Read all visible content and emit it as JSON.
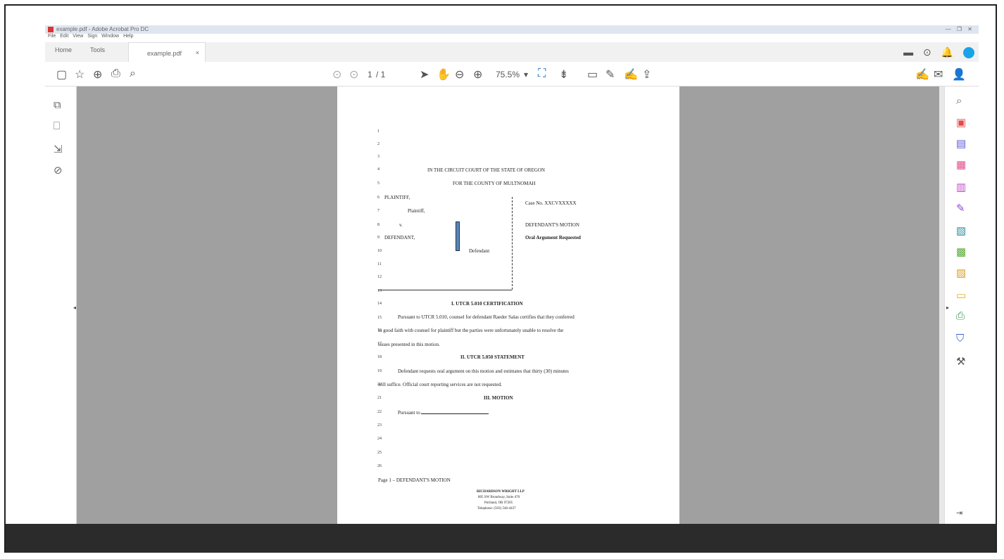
{
  "window": {
    "title": "example.pdf - Adobe Acrobat Pro DC",
    "controls": "— ❐ ✕"
  },
  "menu": [
    "File",
    "Edit",
    "View",
    "Sign",
    "Window",
    "Help"
  ],
  "tabs": {
    "home": "Home",
    "tools": "Tools",
    "document": "example.pdf",
    "close": "×"
  },
  "toolbar": {
    "page_current": "1",
    "page_total": "/ 1",
    "zoom": "75.5%"
  },
  "document": {
    "line_numbers": [
      "1",
      "2",
      "3",
      "4",
      "5",
      "6",
      "7",
      "8",
      "9",
      "10",
      "11",
      "12",
      "13",
      "14",
      "15",
      "16",
      "17",
      "18",
      "19",
      "20",
      "21",
      "22",
      "23",
      "24",
      "25",
      "26"
    ],
    "court_line1": "IN THE CIRCUIT COURT OF THE STATE OF OREGON",
    "court_line2": "FOR THE COUNTY OF MULTNOMAH",
    "plaintiff": "PLAINTIFF,",
    "plaintiff_role": "Plaintiff,",
    "versus": "v.",
    "defendant": "DEFENDANT,",
    "defendant_role": "Defendant",
    "case_no": "Case No. XXCVXXXXX",
    "motion_title": "DEFENDANT'S MOTION",
    "oral_argument": "Oral Argument Requested",
    "section1_heading": "I.     UTCR 5.010 CERTIFICATION",
    "section1_p1": "Pursuant to UTCR 5.010, counsel for defendant Raeder Salas certifies that they conferred",
    "section1_p2": "in good faith with counsel for plaintiff but the parties were unfortunately unable to resolve the",
    "section1_p3": "issues presented in this motion.",
    "section2_heading": "II.     UTCR 5.050 STATEMENT",
    "section2_p1": "Defendant requests oral argument on this motion and estimates that thirty (30) minutes",
    "section2_p2": "will suffice.  Official court reporting services are not requested.",
    "section3_heading": "III.     MOTION",
    "section3_p1": "Pursuant to",
    "footer": "Page 1 – DEFENDANT'S MOTION",
    "firm_name": "RICHARDSON WRIGHT LLP",
    "firm_addr1": "805 SW Broadway, Suite 470",
    "firm_addr2": "Portland, OR 97205",
    "firm_phone": "Telephone: (503) 546-4437"
  },
  "colors": {
    "canvas": "#a0a0a0",
    "accent": "#1a73c7",
    "pdf_red": "#d33333"
  },
  "icons": {
    "left_rail": [
      "pages-icon",
      "bookmark-icon",
      "signatures-icon",
      "attachment-icon"
    ],
    "right_rail": [
      "zoom-icon",
      "export-pdf-icon",
      "edit-pdf-icon",
      "organize-pages-icon",
      "create-pdf-icon",
      "fill-sign-icon",
      "combine-files-icon",
      "scan-icon",
      "send-icon",
      "comment-icon",
      "print-production-icon",
      "protect-icon",
      "more-tools-icon"
    ]
  }
}
